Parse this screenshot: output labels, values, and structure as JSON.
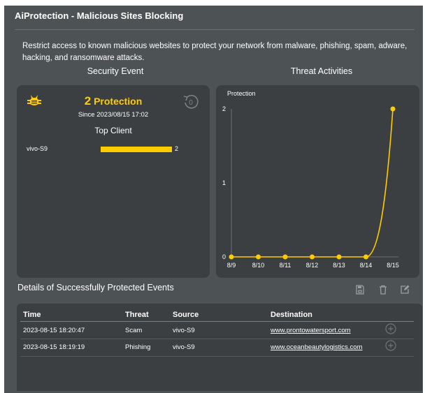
{
  "page": {
    "title": "AiProtection - Malicious Sites Blocking",
    "description": "Restrict access to known malicious websites to protect your network from malware, phishing, spam, adware, hacking, and ransomware attacks."
  },
  "security_event": {
    "heading": "Security Event",
    "count": "2",
    "count_label": "Protection",
    "since": "Since 2023/08/15 17:02",
    "top_client_title": "Top Client",
    "clients": [
      {
        "name": "vivo-S9",
        "count": "2",
        "share": 1.0
      }
    ],
    "icons": {
      "bug": "bug-icon",
      "reset": "reset-counter-icon"
    },
    "colors": {
      "accent": "#ffcc00"
    }
  },
  "threat_activities": {
    "heading": "Threat Activities",
    "chart_data": {
      "type": "line",
      "ylabel": "Protection",
      "categories": [
        "8/9",
        "8/10",
        "8/11",
        "8/12",
        "8/13",
        "8/14",
        "8/15"
      ],
      "series": [
        {
          "values": [
            0,
            0,
            0,
            0,
            0,
            0,
            2
          ]
        }
      ],
      "ylim": [
        0,
        2
      ],
      "yticks": [
        "0",
        "1",
        "2"
      ],
      "color": "#ffcc00",
      "grid": false
    }
  },
  "details": {
    "title": "Details of Successfully Protected Events",
    "toolbar_icons": [
      "save-icon",
      "delete-icon",
      "edit-icon"
    ],
    "columns": [
      "Time",
      "Threat",
      "Source",
      "Destination"
    ],
    "rows": [
      {
        "time": "2023-08-15 18:20:47",
        "threat": "Scam",
        "source": "vivo-S9",
        "destination": "www.prontowatersport.com"
      },
      {
        "time": "2023-08-15 18:19:19",
        "threat": "Phishing",
        "source": "vivo-S9",
        "destination": "www.oceanbeautylogistics.com"
      }
    ]
  }
}
